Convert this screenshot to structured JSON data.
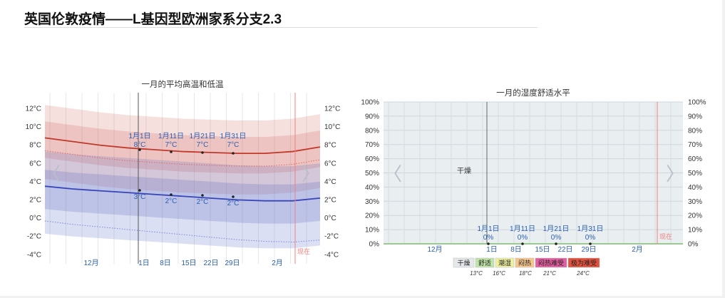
{
  "page": {
    "title": "英国伦敦疫情——L基因型欧洲家系分支2.3"
  },
  "chart_data": [
    {
      "type": "line",
      "title": "一月的平均高温和低温",
      "unit": "°C",
      "ylim": [
        -4,
        12
      ],
      "y_ticks": [
        "12°C",
        "10°C",
        "8°C",
        "6°C",
        "4°C",
        "2°C",
        "0°C",
        "-2°C",
        "-4°C"
      ],
      "x_ticks": [
        "12月",
        "1日",
        "8日",
        "15日",
        "22日",
        "29日",
        "2月"
      ],
      "now_label": "现在",
      "series": [
        {
          "name": "",
          "color": "#c0392b",
          "values": [
            8.8,
            8.4,
            8.0,
            7.7,
            7.5,
            7.3,
            7.2,
            7.1,
            7.1,
            7.3,
            7.8
          ]
        },
        {
          "name": "",
          "color": "#3845b8",
          "values": [
            3.5,
            3.2,
            3.0,
            2.8,
            2.6,
            2.4,
            2.2,
            2.0,
            1.9,
            1.9,
            2.2
          ]
        }
      ],
      "markers": [
        {
          "date": "1月1日",
          "high": "8°C",
          "low": "3°C"
        },
        {
          "date": "1月11日",
          "high": "7°C",
          "low": "2°C"
        },
        {
          "date": "1月21日",
          "high": "7°C",
          "low": "2°C"
        },
        {
          "date": "1月31日",
          "high": "7°C",
          "low": "2°C"
        }
      ],
      "nav": {
        "prev_glyph": "〈",
        "next_glyph": "〉"
      }
    },
    {
      "type": "area",
      "title": "一月的湿度舒适水平",
      "ylim": [
        0,
        100
      ],
      "y_ticks": [
        "100%",
        "90%",
        "80%",
        "70%",
        "60%",
        "50%",
        "40%",
        "30%",
        "20%",
        "10%",
        "0%"
      ],
      "x_ticks": [
        "12月",
        "1日",
        "8日",
        "15日",
        "22日",
        "29日",
        "2月"
      ],
      "now_label": "现在",
      "zone_label": "干燥",
      "markers": [
        {
          "date": "1月1日",
          "value": "0%"
        },
        {
          "date": "1月11日",
          "value": "0%"
        },
        {
          "date": "1月21日",
          "value": "0%"
        },
        {
          "date": "1月31日",
          "value": "0%"
        }
      ],
      "legend": [
        {
          "label": "干燥",
          "color": "#e5e8ea"
        },
        {
          "label": "舒适",
          "color": "#bfe3a8"
        },
        {
          "label": "潮湿",
          "color": "#eef0a0"
        },
        {
          "label": "闷热",
          "color": "#f5c58e"
        },
        {
          "label": "闷热难受",
          "color": "#e25ea0"
        },
        {
          "label": "极为难受",
          "color": "#e0523d"
        }
      ],
      "legend_temps": [
        "13°C",
        "16°C",
        "18°C",
        "21°C",
        "24°C"
      ],
      "nav": {
        "prev_glyph": "〈",
        "next_glyph": "〉"
      }
    }
  ]
}
